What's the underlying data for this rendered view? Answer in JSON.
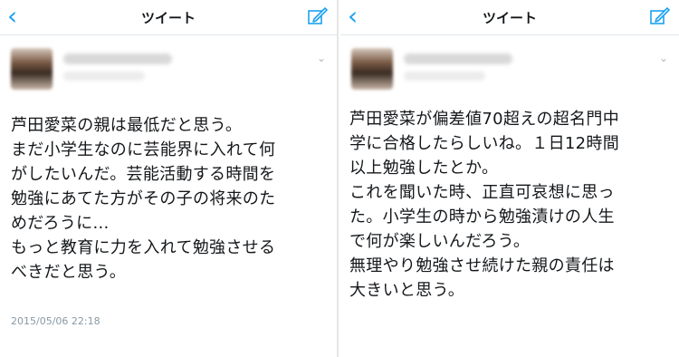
{
  "colors": {
    "accent": "#1da1f2",
    "text": "#14171a",
    "muted": "#8899a6"
  },
  "left": {
    "nav": {
      "back_icon": "chevron-left-icon",
      "title": "ツイート",
      "compose_icon": "compose-icon"
    },
    "tweet": {
      "lines": [
        "芦田愛菜の親は最低だと思う。",
        "まだ小学生なのに芸能界に入れて何",
        "がしたいんだ。芸能活動する時間を",
        "勉強にあてた方がその子の将来のた",
        "めだろうに…",
        "もっと教育に力を入れて勉強させる",
        "べきだと思う。"
      ],
      "timestamp": "2015/05/06 22:18"
    }
  },
  "right": {
    "nav": {
      "back_icon": "chevron-left-icon",
      "title": "ツイート",
      "compose_icon": "compose-icon"
    },
    "tweet": {
      "lines": [
        "芦田愛菜が偏差値70超えの超名門中",
        "学に合格したらしいね。１日12時間",
        "以上勉強したとか。",
        "これを聞いた時、正直可哀想に思っ",
        "た。小学生の時から勉強漬けの人生",
        "で何が楽しいんだろう。",
        "無理やり勉強させ続けた親の責任は",
        "大きいと思う。"
      ]
    }
  }
}
